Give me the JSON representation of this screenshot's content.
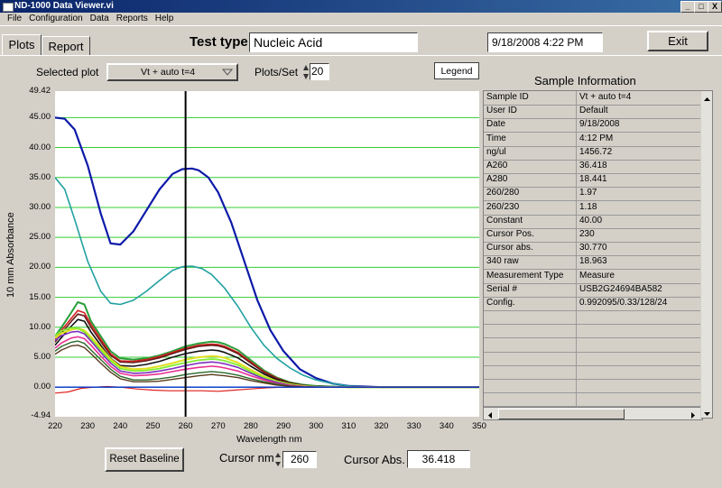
{
  "window": {
    "title": "ND-1000 Data Viewer.vi",
    "controls": [
      "_",
      "□",
      "X"
    ]
  },
  "menu": [
    "File",
    "Configuration",
    "Data",
    "Reports",
    "Help"
  ],
  "tabs": [
    {
      "label": "Plots"
    },
    {
      "label": "Report"
    }
  ],
  "header": {
    "test_type_label": "Test type:",
    "test_type_value": "Nucleic Acid",
    "datetime": "9/18/2008  4:22 PM",
    "exit_label": "Exit"
  },
  "controls": {
    "selected_plot_label": "Selected plot",
    "selected_plot_value": "Vt + auto t=4",
    "plots_per_set_label": "Plots/Set",
    "plots_per_set_value": "20",
    "legend_label": "Legend",
    "reset_baseline_label": "Reset Baseline",
    "cursor_nm_label": "Cursor nm",
    "cursor_nm_value": "260",
    "cursor_abs_label": "Cursor Abs.",
    "cursor_abs_value": "36.418"
  },
  "sample_info": {
    "title": "Sample Information",
    "rows": [
      [
        "Sample ID",
        "Vt + auto t=4"
      ],
      [
        "User ID",
        "Default"
      ],
      [
        "Date",
        "9/18/2008"
      ],
      [
        "Time",
        "4:12 PM"
      ],
      [
        "ng/ul",
        "1456.72"
      ],
      [
        "A260",
        "36.418"
      ],
      [
        "A280",
        "18.441"
      ],
      [
        "260/280",
        "  1.97"
      ],
      [
        "260/230",
        "  1.18"
      ],
      [
        "Constant",
        " 40.00"
      ],
      [
        "Cursor Pos.",
        " 230"
      ],
      [
        "Cursor abs.",
        "30.770"
      ],
      [
        "340 raw",
        "18.963"
      ],
      [
        "Measurement Type",
        "Measure"
      ],
      [
        "Serial #",
        "USB2G24694BA582"
      ],
      [
        "Config.",
        "0.992095/0.33/128/24"
      ],
      [
        "",
        ""
      ],
      [
        "",
        ""
      ],
      [
        "",
        ""
      ],
      [
        "",
        ""
      ],
      [
        "",
        ""
      ],
      [
        "",
        ""
      ],
      [
        "",
        ""
      ]
    ]
  },
  "colors": {
    "grid": "#33cc33",
    "cursor": "#000000",
    "baseline": "#0033cc"
  },
  "chart_data": {
    "type": "line",
    "xlabel": "Wavelength nm",
    "ylabel": "10 mm Absorbance",
    "xlim": [
      220,
      350
    ],
    "ylim": [
      -4.94,
      49.42
    ],
    "xticks": [
      220,
      230,
      240,
      250,
      260,
      270,
      280,
      290,
      300,
      310,
      320,
      330,
      340,
      350
    ],
    "yticks": [
      "49.42",
      "45.00",
      "40.00",
      "35.00",
      "30.00",
      "25.00",
      "20.00",
      "15.00",
      "10.00",
      "5.00",
      "0.00",
      "-4.94"
    ],
    "gridlines_y": [
      45,
      40,
      35,
      30,
      25,
      20,
      15,
      10,
      5,
      0
    ],
    "cursor_x": 260,
    "series": [
      {
        "color": "#0d1aa8",
        "width": 2.2,
        "x": [
          220,
          223,
          226,
          230,
          234,
          237,
          240,
          244,
          248,
          252,
          256,
          259,
          262,
          264,
          267,
          270,
          274,
          278,
          282,
          286,
          290,
          295,
          300,
          305,
          310,
          320,
          330,
          350
        ],
        "y": [
          45,
          44.8,
          43,
          37,
          29,
          24,
          23.8,
          26,
          29.5,
          33,
          35.6,
          36.4,
          36.5,
          36.2,
          35,
          32.5,
          27.5,
          21,
          14.5,
          9.5,
          6,
          3,
          1.5,
          0.6,
          0.2,
          0,
          0,
          0
        ]
      },
      {
        "color": "#22a0a0",
        "width": 1.6,
        "x": [
          220,
          223,
          226,
          230,
          234,
          237,
          240,
          244,
          248,
          252,
          256,
          259,
          262,
          265,
          268,
          272,
          276,
          280,
          284,
          288,
          292,
          296,
          300,
          305,
          310,
          315,
          320,
          350
        ],
        "y": [
          35,
          33,
          28,
          21,
          16,
          14,
          13.8,
          14.5,
          16,
          17.8,
          19.5,
          20.1,
          20.2,
          19.8,
          18.8,
          16.5,
          13.5,
          10,
          7,
          4.8,
          3.2,
          2,
          1.2,
          0.6,
          0.2,
          0.05,
          0,
          0
        ]
      },
      {
        "color": "#2a9e3a",
        "width": 2,
        "x": [
          220,
          222,
          225,
          227,
          229,
          231,
          234,
          237,
          240,
          244,
          248,
          252,
          256,
          260,
          264,
          268,
          270,
          272,
          276,
          280,
          284,
          288,
          292,
          296,
          300,
          310,
          350
        ],
        "y": [
          8.5,
          10,
          12.5,
          14.2,
          13.8,
          11,
          8.5,
          6,
          4.8,
          4.6,
          4.8,
          5.3,
          6,
          6.8,
          7.3,
          7.6,
          7.5,
          7.2,
          6.2,
          4.5,
          2.8,
          1.6,
          0.8,
          0.4,
          0.2,
          0,
          0
        ]
      },
      {
        "color": "#d42020",
        "width": 1.6,
        "x": [
          220,
          222,
          225,
          227,
          229,
          231,
          234,
          237,
          240,
          244,
          248,
          252,
          256,
          260,
          264,
          268,
          270,
          272,
          276,
          280,
          284,
          288,
          292,
          296,
          300,
          310,
          350
        ],
        "y": [
          8,
          9.5,
          11.5,
          12.8,
          12.4,
          10.5,
          8,
          5.6,
          4.4,
          4.3,
          4.6,
          5.1,
          5.8,
          6.5,
          7,
          7.2,
          7.1,
          6.8,
          5.8,
          4.2,
          2.6,
          1.5,
          0.7,
          0.3,
          0.1,
          0,
          0
        ]
      },
      {
        "color": "#6b1a1a",
        "width": 1.6,
        "x": [
          220,
          222,
          225,
          227,
          229,
          231,
          234,
          237,
          240,
          244,
          248,
          252,
          256,
          260,
          264,
          268,
          270,
          272,
          276,
          280,
          284,
          288,
          292,
          296,
          300,
          310,
          350
        ],
        "y": [
          7.5,
          9,
          11,
          12.2,
          11.9,
          10,
          7.6,
          5.3,
          4.2,
          4.1,
          4.4,
          4.9,
          5.6,
          6.3,
          6.8,
          7,
          6.9,
          6.6,
          5.6,
          4,
          2.5,
          1.4,
          0.7,
          0.3,
          0.1,
          0,
          0
        ]
      },
      {
        "color": "#111111",
        "width": 1.6,
        "x": [
          220,
          222,
          225,
          227,
          229,
          231,
          234,
          237,
          240,
          244,
          248,
          252,
          256,
          260,
          264,
          268,
          270,
          272,
          276,
          280,
          284,
          288,
          292,
          296,
          300,
          310,
          350
        ],
        "y": [
          7,
          8.3,
          10.2,
          11.3,
          11,
          9.2,
          7,
          4.8,
          3.6,
          3.5,
          3.8,
          4.3,
          5,
          5.6,
          6,
          6.2,
          6.1,
          5.8,
          4.9,
          3.5,
          2.2,
          1.2,
          0.6,
          0.25,
          0.1,
          0,
          0
        ]
      },
      {
        "color": "#e0e020",
        "width": 2,
        "x": [
          220,
          222,
          225,
          227,
          229,
          231,
          234,
          237,
          240,
          244,
          248,
          252,
          256,
          260,
          264,
          268,
          270,
          272,
          276,
          280,
          284,
          288,
          292,
          296,
          300,
          310,
          350
        ],
        "y": [
          8.2,
          9,
          9.6,
          9.8,
          9.5,
          8.4,
          6.6,
          4.7,
          3.4,
          3,
          3.1,
          3.5,
          4,
          4.6,
          5,
          5.2,
          5.1,
          4.9,
          4.1,
          2.9,
          1.8,
          1,
          0.5,
          0.2,
          0.05,
          0,
          0
        ]
      },
      {
        "color": "#80ee30",
        "width": 1.8,
        "x": [
          220,
          222,
          225,
          227,
          229,
          231,
          234,
          237,
          240,
          244,
          248,
          252,
          256,
          260,
          264,
          268,
          270,
          272,
          276,
          280,
          284,
          288,
          292,
          296,
          300,
          310,
          350
        ],
        "y": [
          8.6,
          9.4,
          9.9,
          9.8,
          9.2,
          8,
          6.2,
          4.4,
          3.1,
          2.7,
          2.8,
          3.1,
          3.6,
          4.1,
          4.5,
          4.7,
          4.6,
          4.4,
          3.7,
          2.6,
          1.6,
          0.9,
          0.4,
          0.15,
          0.05,
          0,
          0
        ]
      },
      {
        "color": "#8030c0",
        "width": 1.6,
        "x": [
          220,
          222,
          225,
          227,
          229,
          231,
          234,
          237,
          240,
          244,
          248,
          252,
          256,
          260,
          264,
          268,
          270,
          272,
          276,
          280,
          284,
          288,
          292,
          296,
          300,
          310,
          350
        ],
        "y": [
          7.8,
          8.6,
          9.2,
          9.3,
          8.9,
          7.7,
          5.8,
          4,
          2.7,
          2.3,
          2.4,
          2.7,
          3.1,
          3.6,
          4,
          4.2,
          4.1,
          3.9,
          3.3,
          2.3,
          1.4,
          0.8,
          0.35,
          0.1,
          0,
          0,
          0
        ]
      },
      {
        "color": "#e83090",
        "width": 1.6,
        "x": [
          220,
          222,
          225,
          227,
          229,
          231,
          234,
          237,
          240,
          244,
          248,
          252,
          256,
          260,
          264,
          268,
          270,
          272,
          276,
          280,
          284,
          288,
          292,
          296,
          300,
          310,
          350
        ],
        "y": [
          6.5,
          7.4,
          8.2,
          8.4,
          8.1,
          7,
          5.2,
          3.5,
          2.3,
          1.9,
          2,
          2.2,
          2.6,
          3,
          3.3,
          3.5,
          3.4,
          3.2,
          2.7,
          1.9,
          1.2,
          0.6,
          0.3,
          0.1,
          0,
          0,
          0
        ]
      },
      {
        "color": "#2a6a2a",
        "width": 1.4,
        "x": [
          220,
          222,
          225,
          227,
          229,
          231,
          234,
          237,
          240,
          244,
          248,
          252,
          256,
          260,
          264,
          268,
          270,
          272,
          276,
          280,
          284,
          288,
          292,
          296,
          300,
          310,
          350
        ],
        "y": [
          6,
          6.8,
          7.5,
          7.7,
          7.3,
          6.2,
          4.6,
          3,
          1.8,
          1.2,
          1.2,
          1.4,
          1.7,
          2.1,
          2.4,
          2.6,
          2.5,
          2.4,
          2,
          1.4,
          0.9,
          0.5,
          0.2,
          0.05,
          0,
          0,
          0
        ]
      },
      {
        "color": "#5a3a1a",
        "width": 1.4,
        "x": [
          220,
          222,
          225,
          227,
          229,
          231,
          234,
          237,
          240,
          244,
          248,
          252,
          256,
          260,
          264,
          268,
          270,
          272,
          276,
          280,
          284,
          288,
          292,
          296,
          300,
          310,
          350
        ],
        "y": [
          5.5,
          6.2,
          6.9,
          7,
          6.6,
          5.6,
          4,
          2.5,
          1.4,
          0.9,
          0.9,
          1,
          1.3,
          1.6,
          1.9,
          2.1,
          2,
          1.9,
          1.6,
          1.1,
          0.7,
          0.35,
          0.15,
          0.05,
          0,
          0,
          0
        ]
      },
      {
        "color": "#e02020",
        "width": 1.2,
        "x": [
          220,
          224,
          228,
          232,
          236,
          240,
          245,
          250,
          255,
          260,
          265,
          270,
          275,
          280,
          285,
          290,
          300,
          320,
          350
        ],
        "y": [
          -1,
          -0.8,
          -0.2,
          0,
          0.1,
          0,
          -0.3,
          -0.5,
          -0.6,
          -0.6,
          -0.6,
          -0.7,
          -0.5,
          -0.3,
          -0.1,
          0,
          0,
          0,
          0
        ]
      },
      {
        "color": "#0033cc",
        "width": 1.4,
        "x": [
          220,
          350
        ],
        "y": [
          0,
          0
        ]
      }
    ]
  }
}
